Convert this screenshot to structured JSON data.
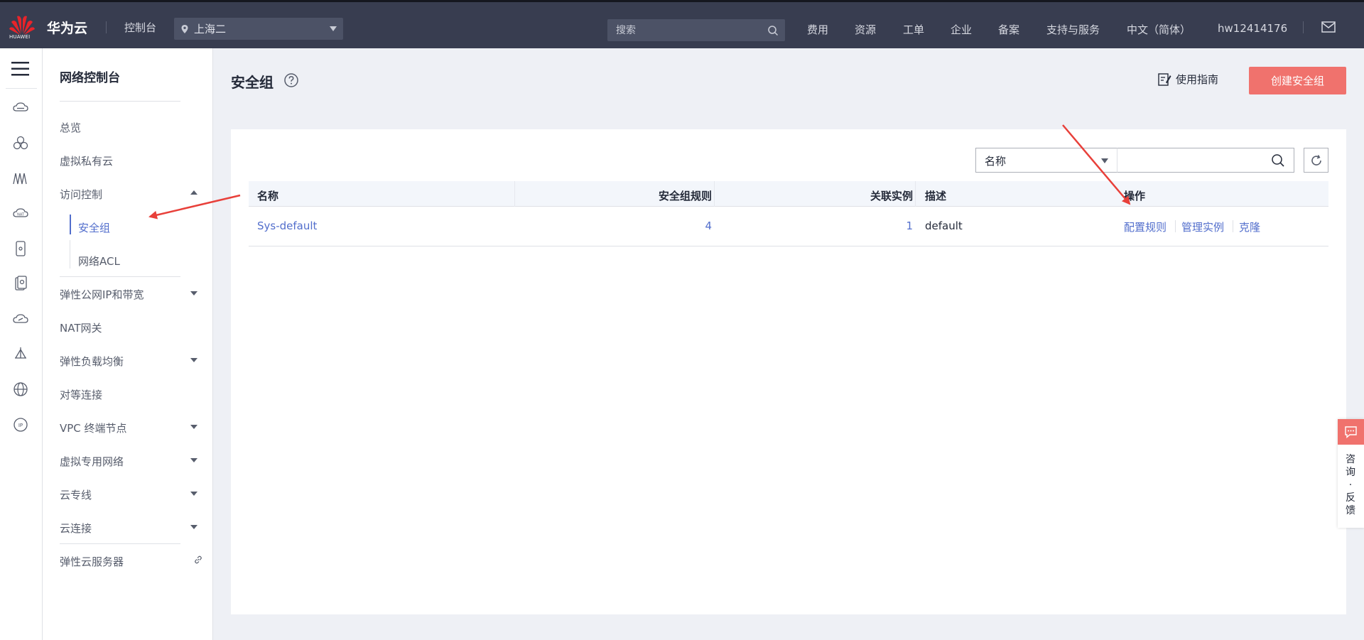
{
  "header": {
    "logo_text": "HUAWEI",
    "brand": "华为云",
    "console": "控制台",
    "region": "上海二",
    "search_placeholder": "搜索",
    "nav": [
      "费用",
      "资源",
      "工单",
      "企业",
      "备案",
      "支持与服务",
      "中文（简体）",
      "hw12414176"
    ]
  },
  "rail": {
    "icons": [
      "menu-icon",
      "cloud-server-icon",
      "cluster-icon",
      "network-icon",
      "gateway-icon",
      "device-icon",
      "disk-icon",
      "cloud-icon",
      "elb-icon",
      "globe-icon",
      "ip-icon"
    ]
  },
  "sidebar": {
    "title": "网络控制台",
    "items": [
      {
        "label": "总览"
      },
      {
        "label": "虚拟私有云"
      },
      {
        "label": "访问控制"
      },
      {
        "label": "安全组"
      },
      {
        "label": "网络ACL"
      },
      {
        "label": "弹性公网IP和带宽"
      },
      {
        "label": "NAT网关"
      },
      {
        "label": "弹性负载均衡"
      },
      {
        "label": "对等连接"
      },
      {
        "label": "VPC 终端节点"
      },
      {
        "label": "虚拟专用网络"
      },
      {
        "label": "云专线"
      },
      {
        "label": "云连接"
      },
      {
        "label": "弹性云服务器"
      }
    ]
  },
  "main": {
    "title": "安全组",
    "guide": "使用指南",
    "create": "创建安全组",
    "filter_select": "名称",
    "columns": [
      "名称",
      "安全组规则",
      "关联实例",
      "描述",
      "操作"
    ],
    "rows": [
      {
        "name": "Sys-default",
        "rules": "4",
        "instances": "1",
        "desc": "default",
        "ops": [
          "配置规则",
          "管理实例",
          "克隆"
        ]
      }
    ]
  },
  "feedback": {
    "label": "咨询·反馈"
  },
  "colors": {
    "topbar": "#383d50",
    "accent": "#526ecc",
    "primary_button": "#f0726d",
    "annotation_arrow": "#e8403a"
  }
}
